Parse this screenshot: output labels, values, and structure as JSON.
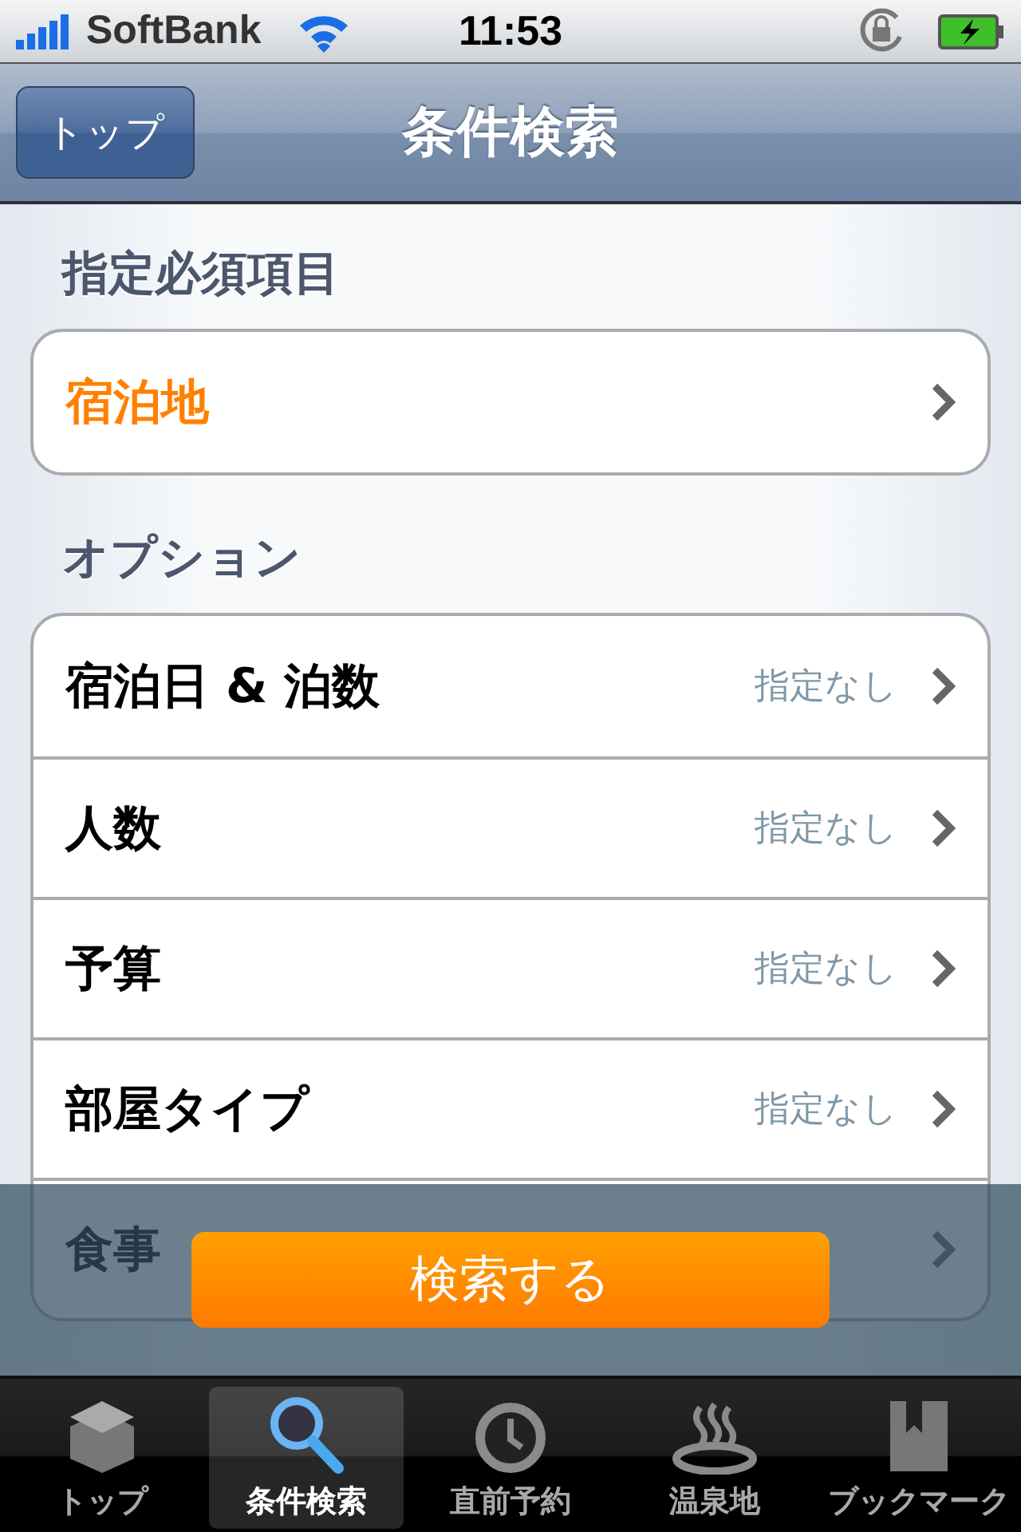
{
  "status_bar": {
    "carrier": "SoftBank",
    "time": "11:53"
  },
  "nav_bar": {
    "back_button": "トップ",
    "title": "条件検索"
  },
  "sections": [
    {
      "header": "指定必須項目",
      "rows": [
        {
          "label": "宿泊地",
          "required": true
        }
      ]
    },
    {
      "header": "オプション",
      "rows": [
        {
          "label": "宿泊日 & 泊数",
          "value": "指定なし",
          "required": false
        },
        {
          "label": "人数",
          "value": "指定なし",
          "required": false
        },
        {
          "label": "予算",
          "value": "指定なし",
          "required": false
        },
        {
          "label": "部屋タイプ",
          "value": "指定なし",
          "required": false
        },
        {
          "label": "食事",
          "required": false
        }
      ]
    }
  ],
  "search_button": "検索する",
  "tab_bar": [
    {
      "label": "トップ",
      "selected": false,
      "kind": "box"
    },
    {
      "label": "条件検索",
      "selected": true,
      "kind": "search"
    },
    {
      "label": "直前予約",
      "selected": false,
      "kind": "clock"
    },
    {
      "label": "温泉地",
      "selected": false,
      "kind": "onsen"
    },
    {
      "label": "ブックマーク",
      "selected": false,
      "kind": "bookmark"
    }
  ]
}
